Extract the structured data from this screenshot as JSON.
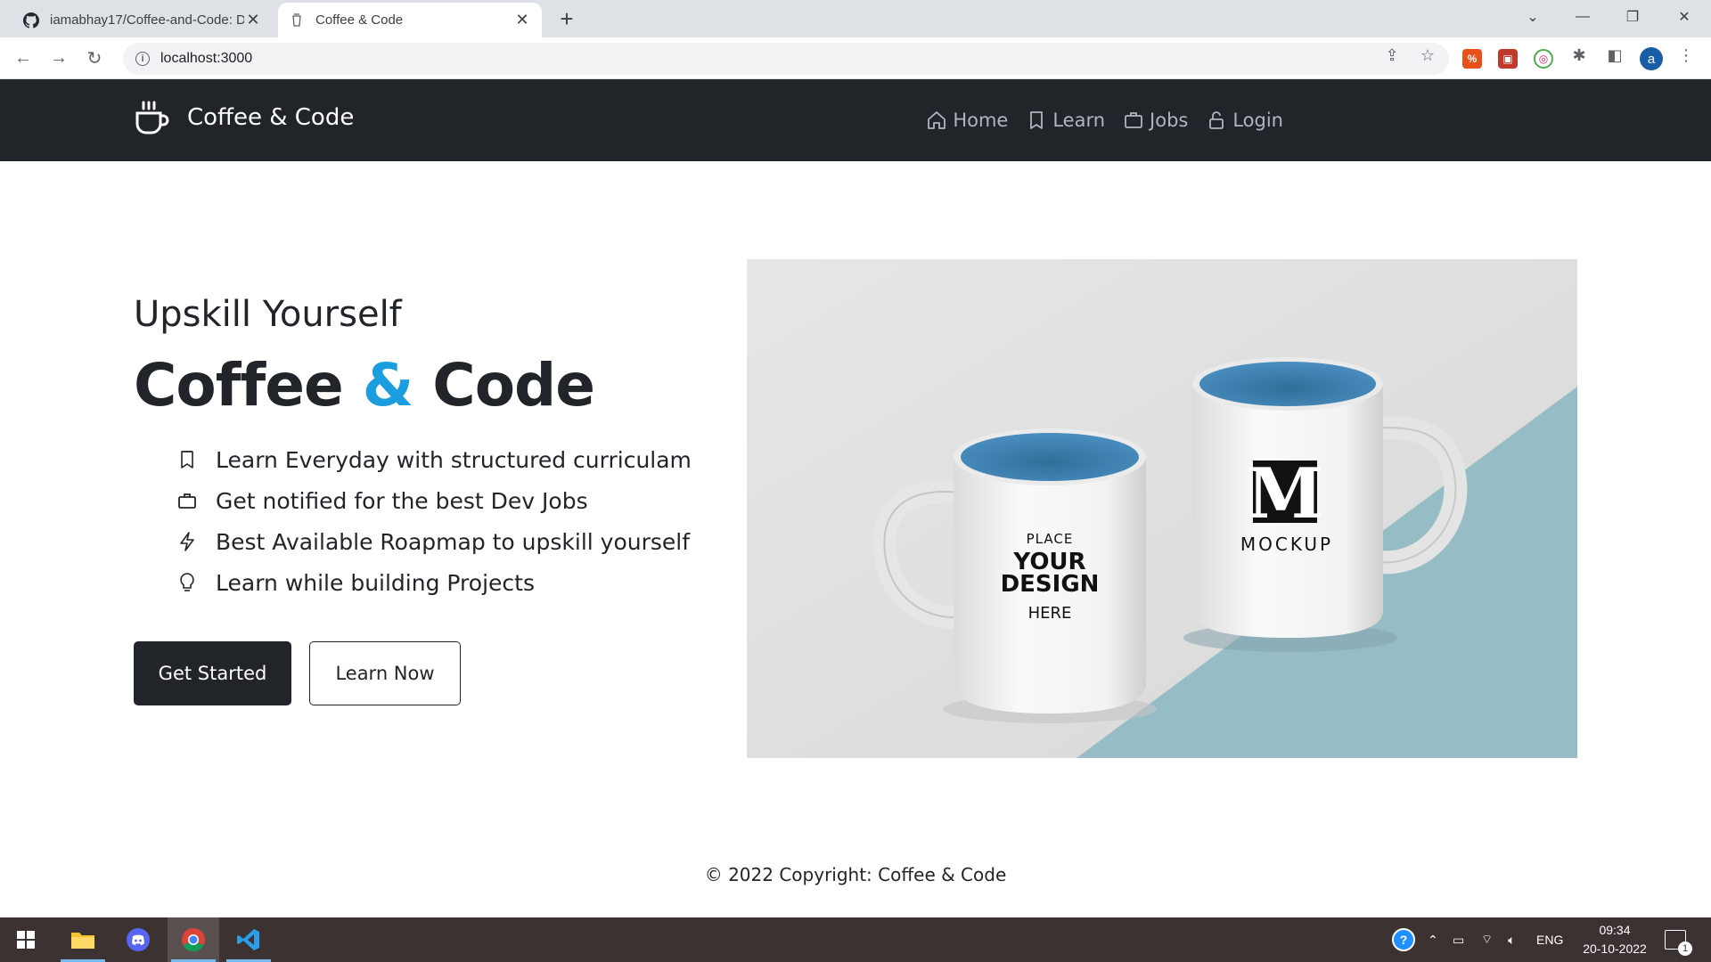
{
  "browser": {
    "tabs": [
      {
        "title": "iamabhay17/Coffee-and-Code: D",
        "icon": "github-icon",
        "active": false
      },
      {
        "title": "Coffee & Code",
        "icon": "coffee-cup-icon",
        "active": true
      }
    ],
    "url": "localhost:3000",
    "profile_initial": "a"
  },
  "navbar": {
    "brand": "Coffee & Code",
    "links": [
      {
        "label": "Home",
        "icon": "home-icon"
      },
      {
        "label": "Learn",
        "icon": "bookmark-icon"
      },
      {
        "label": "Jobs",
        "icon": "briefcase-icon"
      },
      {
        "label": "Login",
        "icon": "lock-icon"
      }
    ]
  },
  "hero": {
    "subtitle": "Upskill Yourself",
    "headline_part1": "Coffee",
    "headline_amp": "&",
    "headline_part2": "Code",
    "features": [
      {
        "text": "Learn Everyday with structured curriculam",
        "icon": "bookmark-icon"
      },
      {
        "text": "Get notified for the best Dev Jobs",
        "icon": "briefcase-icon"
      },
      {
        "text": "Best Available Roapmap to upskill yourself",
        "icon": "lightning-icon"
      },
      {
        "text": "Learn while building Projects",
        "icon": "lightbulb-icon"
      }
    ],
    "primary_button": "Get Started",
    "secondary_button": "Learn Now",
    "image": {
      "mug_left_text": [
        "PLACE",
        "YOUR",
        "DESIGN",
        "HERE"
      ],
      "mug_right_logo": "M",
      "mug_right_text": "MOCKUP"
    }
  },
  "footer": {
    "text": "© 2022 Copyright: Coffee & Code"
  },
  "taskbar": {
    "language": "ENG",
    "time": "09:34",
    "date": "20-10-2022",
    "notification_count": "1"
  },
  "colors": {
    "navbar_bg": "#212529",
    "accent": "#1a9ee0",
    "text": "#212529"
  }
}
